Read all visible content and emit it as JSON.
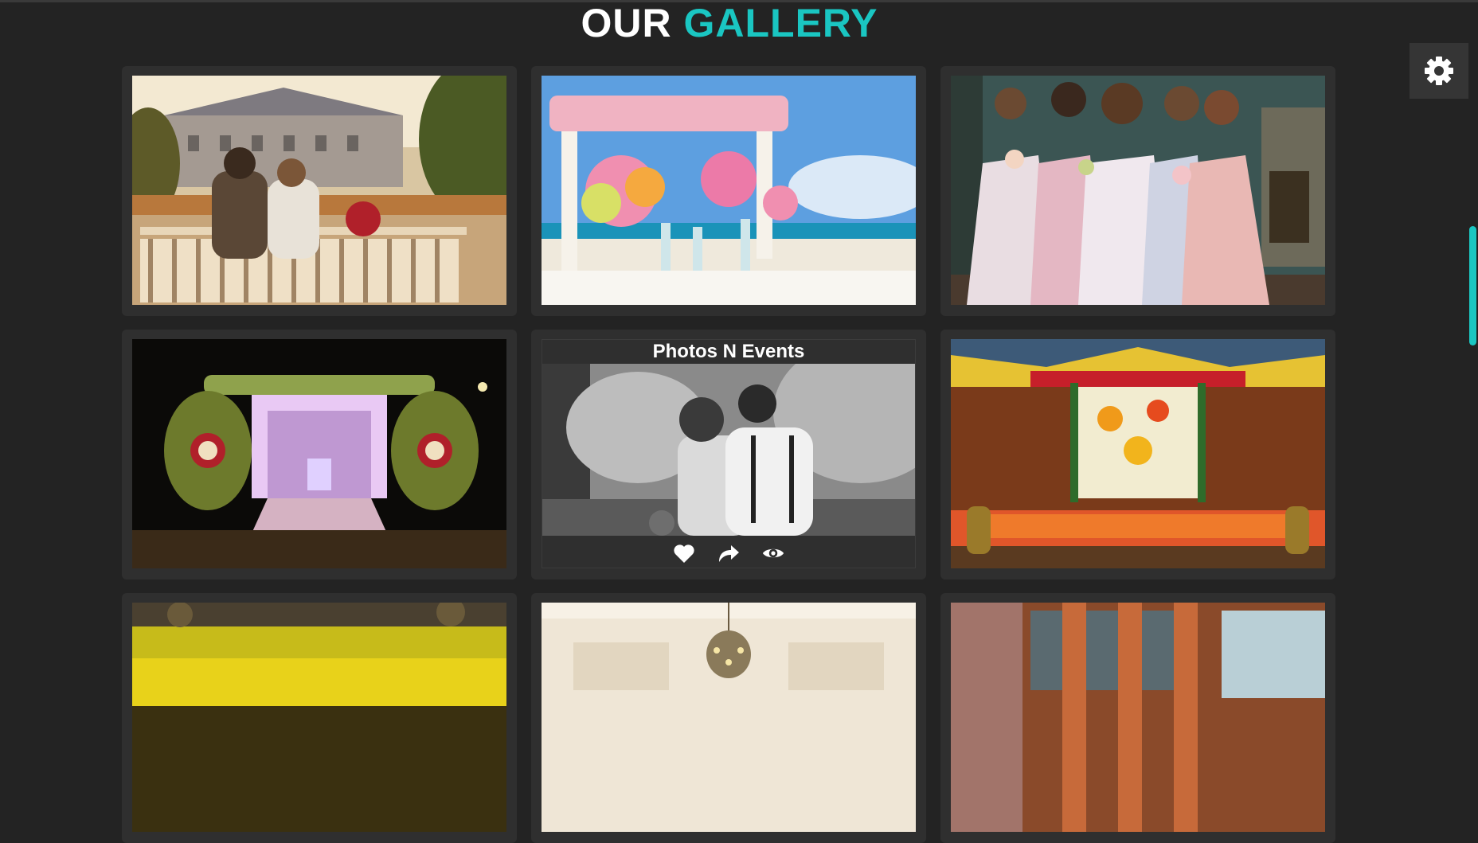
{
  "header": {
    "title_part1": "OUR",
    "title_part2": "GALLERY"
  },
  "colors": {
    "background": "#232323",
    "accent": "#1ac6c2",
    "card": "#2f2f2f"
  },
  "settings_button": {
    "icon": "gear-icon"
  },
  "gallery": {
    "items": [
      {
        "name": "couple-on-bench-photo"
      },
      {
        "name": "beach-wedding-table-photo"
      },
      {
        "name": "bridesmaids-photo"
      },
      {
        "name": "lit-flower-entrance-photo"
      },
      {
        "name": "couple-black-white-photo",
        "hover_title": "Photos N Events"
      },
      {
        "name": "floral-stage-decor-photo"
      },
      {
        "name": "banquet-hall-yellow-photo"
      },
      {
        "name": "chandelier-hall-photo"
      },
      {
        "name": "arched-windows-hall-photo"
      }
    ],
    "hover_actions": [
      "heart-icon",
      "share-icon",
      "eye-icon"
    ]
  }
}
